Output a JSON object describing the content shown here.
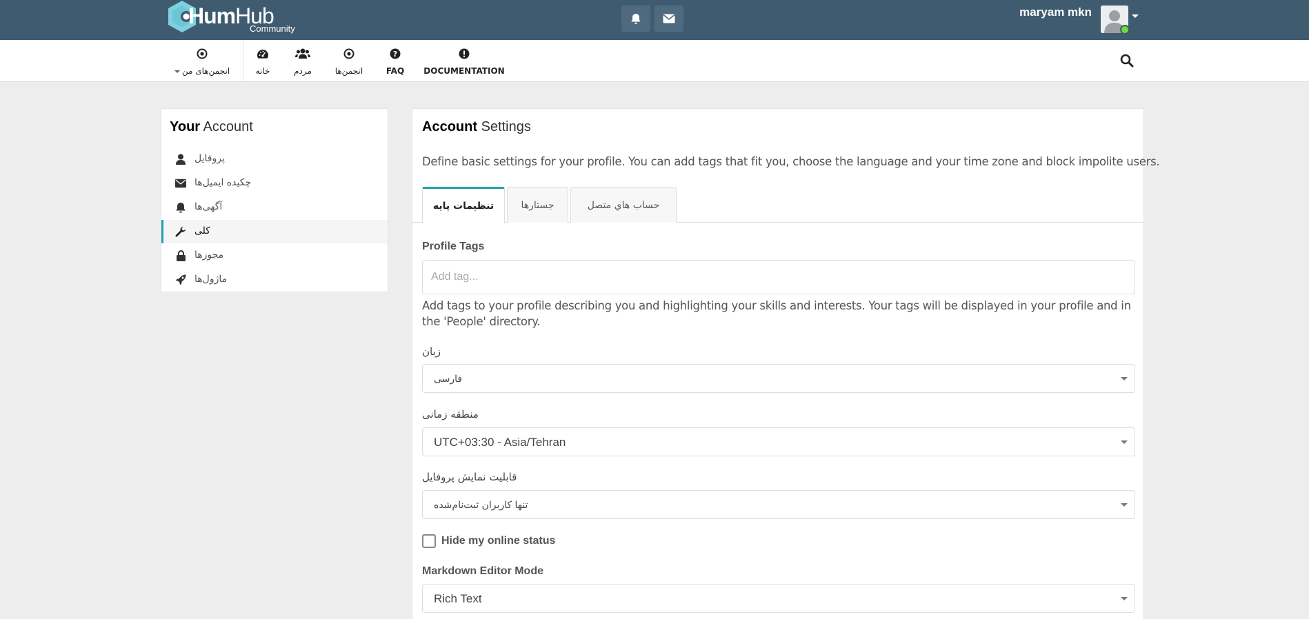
{
  "topbar": {
    "logo_bold": "Hum",
    "logo_light": "Hub",
    "logo_sub": "Community",
    "user_name": "maryam mkn",
    "colors": {
      "bar": "#3f5b6f",
      "accent": "#21a1b3",
      "online": "#6fdb3d"
    }
  },
  "nav": {
    "my_spaces": "انجمن‌های من",
    "items": [
      {
        "label": "خانه",
        "icon": "dashboard-icon"
      },
      {
        "label": "مردم",
        "icon": "users-icon"
      },
      {
        "label": "انجمن‌ها",
        "icon": "dot-circle-icon"
      },
      {
        "label": "FAQ",
        "icon": "question-circle-icon"
      },
      {
        "label": "DOCUMENTATION",
        "icon": "exclamation-circle-icon"
      }
    ]
  },
  "sidebar": {
    "title_bold": "Your",
    "title_rest": "Account",
    "items": [
      {
        "label": "پروفایل",
        "icon": "user-icon"
      },
      {
        "label": "چکیده ایمیل‌ها",
        "icon": "envelope-icon"
      },
      {
        "label": "آگهی‌ها",
        "icon": "bell-icon"
      },
      {
        "label": "کلی",
        "icon": "wrench-icon"
      },
      {
        "label": "مجوزها",
        "icon": "lock-icon"
      },
      {
        "label": "ماژول‌ها",
        "icon": "rocket-icon"
      }
    ],
    "active_index": 3
  },
  "main": {
    "title_bold": "Account",
    "title_rest": "Settings",
    "description": "Define basic settings for your profile. You can add tags that fit you, choose the language and your time zone and block impolite users.",
    "tabs": [
      {
        "label": "تنظیمات پایه"
      },
      {
        "label": "جستارها"
      },
      {
        "label": "حساب هاي متصل"
      }
    ],
    "profile_tags_label": "Profile Tags",
    "profile_tags_placeholder": "Add tag...",
    "profile_tags_help": "Add tags to your profile describing you and highlighting your skills and interests. Your tags will be displayed in your profile and in the 'People' directory.",
    "language_label": "زبان",
    "language_value": "فارسی",
    "timezone_label": "منطقه زمانی",
    "timezone_value": "UTC+03:30 - Asia/Tehran",
    "visibility_label": "قابلیت نمایش پروفایل",
    "visibility_value": "تنها کاربران ثبت‌نام‌شده",
    "hide_online_label": "Hide my online status",
    "hide_online_checked": false,
    "markdown_label": "Markdown Editor Mode",
    "markdown_value": "Rich Text"
  }
}
